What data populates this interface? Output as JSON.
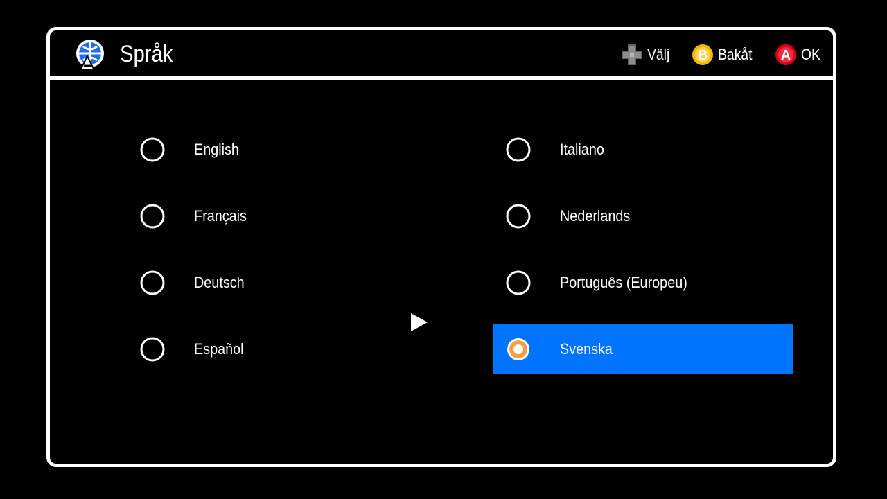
{
  "header": {
    "title": "Språk",
    "title_icon": "language-globe-icon",
    "hints": [
      {
        "icon": "dpad-icon",
        "label": "Välj"
      },
      {
        "icon": "b-button-icon",
        "label": "Bakåt",
        "color": "#f5b800"
      },
      {
        "icon": "a-button-icon",
        "label": "OK",
        "color": "#e0001a"
      }
    ]
  },
  "languages": {
    "left": [
      "English",
      "Français",
      "Deutsch",
      "Español"
    ],
    "right": [
      "Italiano",
      "Nederlands",
      "Português (Europeu)",
      "Svenska"
    ]
  },
  "selected": "Svenska",
  "colors": {
    "selection_bg": "#0074ff",
    "selected_radio": "#f5a040",
    "background": "#000000",
    "foreground": "#ffffff"
  }
}
